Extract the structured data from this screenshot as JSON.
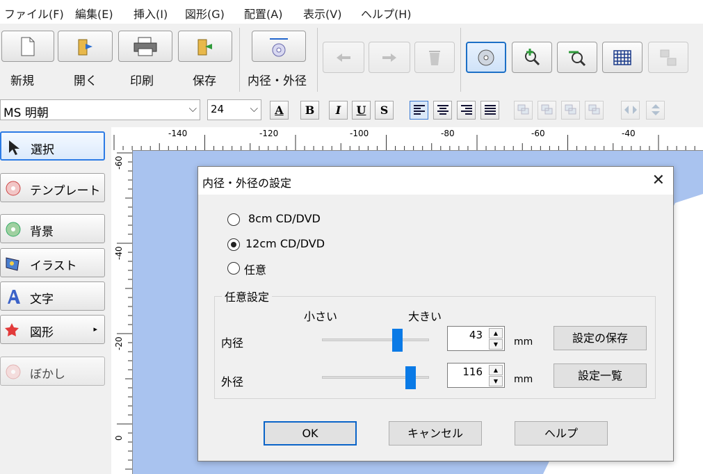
{
  "menubar": {
    "items": [
      "ファイル(F)",
      "編集(E)",
      "挿入(I)",
      "図形(G)",
      "配置(A)",
      "表示(V)",
      "ヘルプ(H)"
    ]
  },
  "toolbar": {
    "new_label": "新規",
    "open_label": "開く",
    "print_label": "印刷",
    "save_label": "保存",
    "diameter_label": "内径・外径"
  },
  "formatbar": {
    "font_name": "MS 明朝",
    "font_size": "24",
    "underline_a": "A",
    "bold": "B",
    "italic": "I",
    "underline": "U",
    "strike": "S"
  },
  "leftpanel": {
    "items": [
      "選択",
      "テンプレート",
      "背景",
      "イラスト",
      "文字",
      "図形",
      "ぼかし"
    ]
  },
  "ruler": {
    "top_labels": [
      "-140",
      "-120",
      "-100",
      "-80",
      "-60",
      "-40"
    ],
    "left_labels": [
      "-60",
      "-40",
      "-20",
      "0"
    ]
  },
  "dialog": {
    "title": "内径・外径の設定",
    "close": "✕",
    "options": [
      "8cm CD/DVD",
      "12cm CD/DVD",
      "任意"
    ],
    "selected_index": 1,
    "group_title": "任意設定",
    "small_label": "小さい",
    "large_label": "大きい",
    "inner_label": "内径",
    "outer_label": "外径",
    "inner_value": "43",
    "outer_value": "116",
    "inner_slider_fraction": 0.73,
    "outer_slider_fraction": 0.86,
    "unit": "mm",
    "save_settings_label": "設定の保存",
    "settings_list_label": "設定一覧",
    "ok_label": "OK",
    "cancel_label": "キャンセル",
    "help_label": "ヘルプ"
  },
  "colors": {
    "canvas": "#a9c3ef",
    "accent": "#0a7ae6"
  }
}
